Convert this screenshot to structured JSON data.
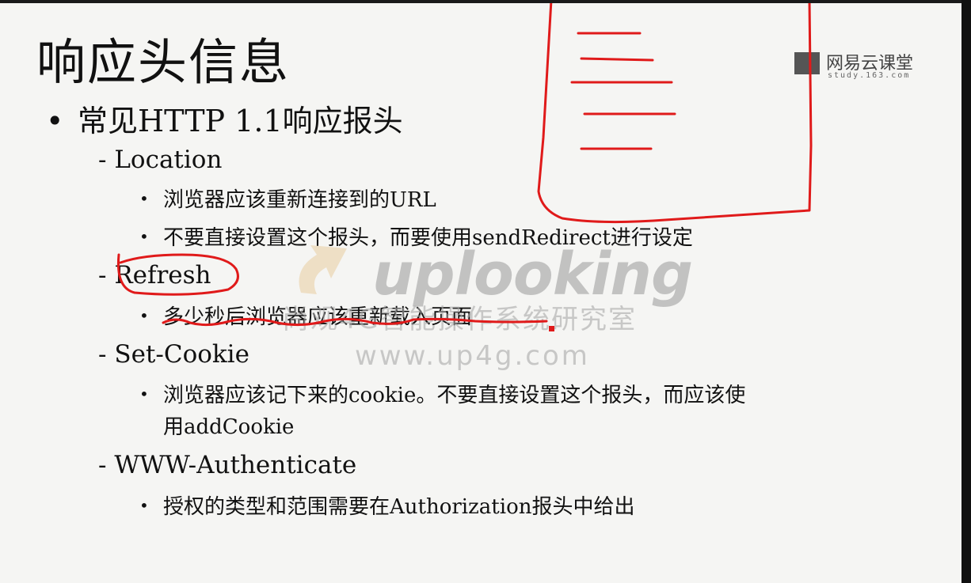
{
  "slide": {
    "title": "响应头信息",
    "level1": "常见HTTP 1.1响应报头",
    "bullet_dot": "•",
    "sections": [
      {
        "heading": "- Location",
        "items": [
          "浏览器应该重新连接到的URL",
          "不要直接设置这个报头，而要使用sendRedirect进行设定"
        ]
      },
      {
        "heading": "- Refresh",
        "items": [
          "多少秒后浏览器应该重新载入页面"
        ]
      },
      {
        "heading": "- Set-Cookie",
        "items_line1": "浏览器应该记下来的cookie。不要直接设置这个报头，而应该使",
        "items_line2": "用addCookie"
      },
      {
        "heading": "- WWW-Authenticate",
        "items": [
          "授权的类型和范围需要在Authorization报头中给出"
        ]
      }
    ]
  },
  "watermark": {
    "brand": "uplooking",
    "subtitle": "尚观4G智能操作系统研究室",
    "url": "www.up4g.com"
  },
  "netease": {
    "name": "网易云课堂",
    "domain": "study.163.com"
  },
  "colors": {
    "annotation_red": "#e01a1a",
    "slide_bg": "#f5f5f3"
  }
}
